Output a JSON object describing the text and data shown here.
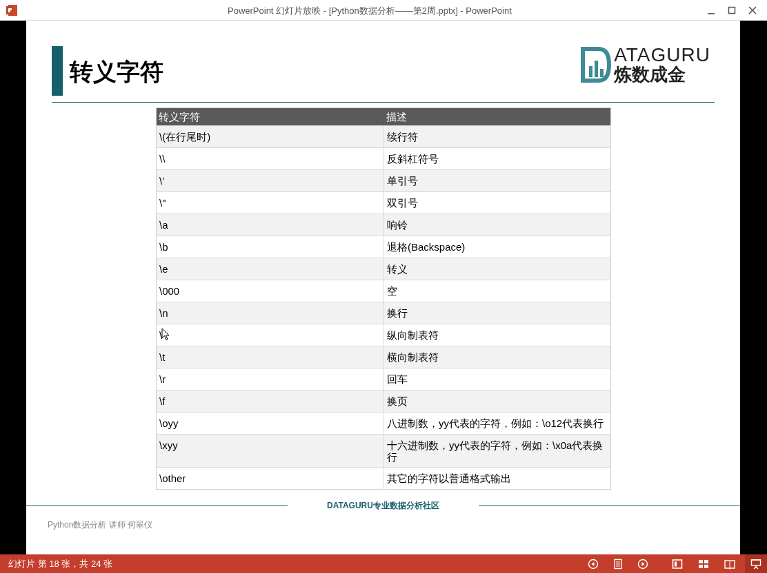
{
  "window": {
    "title": "PowerPoint 幻灯片放映 - [Python数据分析——第2周.pptx] - PowerPoint"
  },
  "slide": {
    "title": "转义字符",
    "logo": {
      "top": "ATAGURU",
      "bottom": "炼数成金"
    },
    "table": {
      "columns": [
        "转义字符",
        "描述"
      ],
      "rows": [
        [
          "\\(在行尾时)",
          "续行符"
        ],
        [
          "\\\\",
          "反斜杠符号"
        ],
        [
          "\\'",
          "单引号"
        ],
        [
          "\\\"",
          "双引号"
        ],
        [
          "\\a",
          "响铃"
        ],
        [
          "\\b",
          "退格(Backspace)"
        ],
        [
          "\\e",
          "转义"
        ],
        [
          "\\000",
          "空"
        ],
        [
          "\\n",
          "换行"
        ],
        [
          "\\",
          "纵向制表符"
        ],
        [
          "\\t",
          "横向制表符"
        ],
        [
          "\\r",
          "回车"
        ],
        [
          "\\f",
          "换页"
        ],
        [
          "\\oyy",
          "八进制数，yy代表的字符，例如：\\o12代表换行"
        ],
        [
          "\\xyy",
          "十六进制数，yy代表的字符，例如：\\x0a代表换行"
        ],
        [
          "\\other",
          "其它的字符以普通格式输出"
        ]
      ]
    },
    "footer": {
      "center": "DATAGURU专业数据分析社区",
      "left": "Python数据分析 讲师 何翠仪"
    }
  },
  "status_bar": {
    "text": "幻灯片 第 18 张，共 24 张",
    "buttons": [
      {
        "kind": "prev",
        "selected": false
      },
      {
        "kind": "menu",
        "selected": false
      },
      {
        "kind": "next",
        "selected": false
      },
      {
        "kind": "normal",
        "selected": false
      },
      {
        "kind": "sorter",
        "selected": false
      },
      {
        "kind": "reading",
        "selected": false
      },
      {
        "kind": "show",
        "selected": true
      }
    ]
  }
}
